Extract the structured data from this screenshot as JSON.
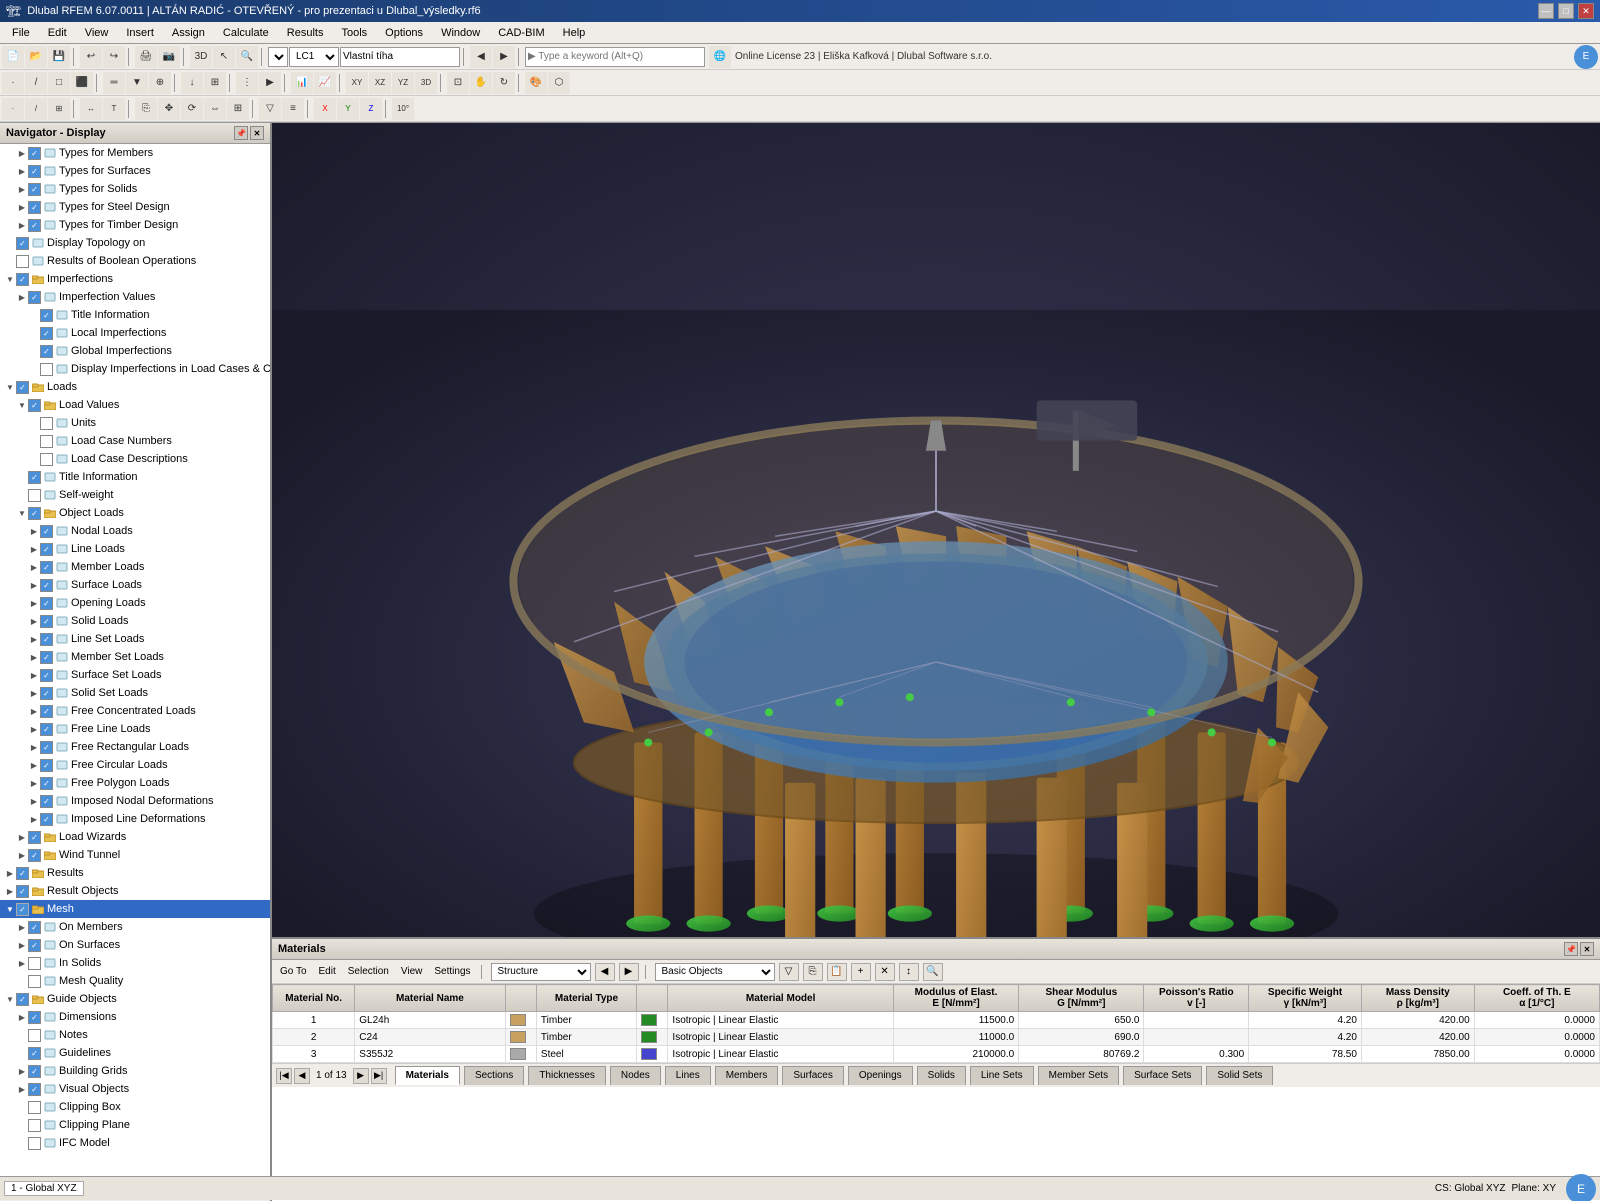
{
  "titleBar": {
    "text": "Dlubal RFEM 6.07.0011 | ALTÁN RADIĆ - OTEVŘENÝ - pro prezentaci u Dlubal_výsledky.rf6",
    "controls": [
      "—",
      "□",
      "✕"
    ]
  },
  "menuBar": {
    "items": [
      "File",
      "Edit",
      "View",
      "Insert",
      "Assign",
      "Calculate",
      "Results",
      "Tools",
      "Options",
      "Window",
      "CAD-BIM",
      "Help"
    ]
  },
  "toolbar1": {
    "searchPlaceholder": "▶ Type a keyword (Alt+Q)",
    "licenseText": "Online License 23 | Eliška Kafková | Dlubal Software s.r.o.",
    "loadCombo": "LC1",
    "loadName": "Vlastní tíha"
  },
  "navigator": {
    "title": "Navigator - Display",
    "items": [
      {
        "id": "types-members",
        "label": "Types for Members",
        "level": 1,
        "expand": "▶",
        "checked": true,
        "icon": "📋"
      },
      {
        "id": "types-surfaces",
        "label": "Types for Surfaces",
        "level": 1,
        "expand": "▶",
        "checked": true,
        "icon": "📋"
      },
      {
        "id": "types-solids",
        "label": "Types for Solids",
        "level": 1,
        "expand": "▶",
        "checked": true,
        "icon": "📋"
      },
      {
        "id": "types-steel",
        "label": "Types for Steel Design",
        "level": 1,
        "expand": "▶",
        "checked": true,
        "icon": "📋"
      },
      {
        "id": "types-timber",
        "label": "Types for Timber Design",
        "level": 1,
        "expand": "▶",
        "checked": true,
        "icon": "📋"
      },
      {
        "id": "display-topology",
        "label": "Display Topology on",
        "level": 0,
        "expand": "",
        "checked": true,
        "icon": "🔲"
      },
      {
        "id": "boolean-results",
        "label": "Results of Boolean Operations",
        "level": 0,
        "expand": "",
        "checked": false,
        "icon": "🔲"
      },
      {
        "id": "imperfections",
        "label": "Imperfections",
        "level": 0,
        "expand": "▼",
        "checked": true,
        "icon": "📁"
      },
      {
        "id": "imperfection-values",
        "label": "Imperfection Values",
        "level": 1,
        "expand": "▶",
        "checked": true,
        "icon": "📄"
      },
      {
        "id": "title-info-imp",
        "label": "Title Information",
        "level": 2,
        "expand": "",
        "checked": true,
        "icon": "📄"
      },
      {
        "id": "local-imperfections",
        "label": "Local Imperfections",
        "level": 2,
        "expand": "",
        "checked": true,
        "icon": "📄"
      },
      {
        "id": "global-imperfections",
        "label": "Global Imperfections",
        "level": 2,
        "expand": "",
        "checked": true,
        "icon": "📄"
      },
      {
        "id": "display-imperfections",
        "label": "Display Imperfections in Load Cases & Combi...",
        "level": 2,
        "expand": "",
        "checked": false,
        "icon": "📄"
      },
      {
        "id": "loads",
        "label": "Loads",
        "level": 0,
        "expand": "▼",
        "checked": true,
        "icon": "📁"
      },
      {
        "id": "load-values",
        "label": "Load Values",
        "level": 1,
        "expand": "▼",
        "checked": true,
        "icon": "📁"
      },
      {
        "id": "units",
        "label": "Units",
        "level": 2,
        "expand": "",
        "checked": false,
        "icon": "📄"
      },
      {
        "id": "load-case-numbers",
        "label": "Load Case Numbers",
        "level": 2,
        "expand": "",
        "checked": false,
        "icon": "📄"
      },
      {
        "id": "load-case-desc",
        "label": "Load Case Descriptions",
        "level": 2,
        "expand": "",
        "checked": false,
        "icon": "📄"
      },
      {
        "id": "title-info-loads",
        "label": "Title Information",
        "level": 1,
        "expand": "",
        "checked": true,
        "icon": "📄"
      },
      {
        "id": "self-weight",
        "label": "Self-weight",
        "level": 1,
        "expand": "",
        "checked": false,
        "icon": "📄"
      },
      {
        "id": "object-loads",
        "label": "Object Loads",
        "level": 1,
        "expand": "▼",
        "checked": true,
        "icon": "📁"
      },
      {
        "id": "nodal-loads",
        "label": "Nodal Loads",
        "level": 2,
        "expand": "▶",
        "checked": true,
        "icon": "📄"
      },
      {
        "id": "line-loads",
        "label": "Line Loads",
        "level": 2,
        "expand": "▶",
        "checked": true,
        "icon": "📄"
      },
      {
        "id": "member-loads",
        "label": "Member Loads",
        "level": 2,
        "expand": "▶",
        "checked": true,
        "icon": "📄"
      },
      {
        "id": "surface-loads",
        "label": "Surface Loads",
        "level": 2,
        "expand": "▶",
        "checked": true,
        "icon": "📄"
      },
      {
        "id": "opening-loads",
        "label": "Opening Loads",
        "level": 2,
        "expand": "▶",
        "checked": true,
        "icon": "📄"
      },
      {
        "id": "solid-loads",
        "label": "Solid Loads",
        "level": 2,
        "expand": "▶",
        "checked": true,
        "icon": "📄"
      },
      {
        "id": "line-set-loads",
        "label": "Line Set Loads",
        "level": 2,
        "expand": "▶",
        "checked": true,
        "icon": "📄"
      },
      {
        "id": "member-set-loads",
        "label": "Member Set Loads",
        "level": 2,
        "expand": "▶",
        "checked": true,
        "icon": "📄"
      },
      {
        "id": "surface-set-loads",
        "label": "Surface Set Loads",
        "level": 2,
        "expand": "▶",
        "checked": true,
        "icon": "📄"
      },
      {
        "id": "solid-set-loads",
        "label": "Solid Set Loads",
        "level": 2,
        "expand": "▶",
        "checked": true,
        "icon": "📄"
      },
      {
        "id": "free-conc-loads",
        "label": "Free Concentrated Loads",
        "level": 2,
        "expand": "▶",
        "checked": true,
        "icon": "📄"
      },
      {
        "id": "free-line-loads",
        "label": "Free Line Loads",
        "level": 2,
        "expand": "▶",
        "checked": true,
        "icon": "📄"
      },
      {
        "id": "free-rect-loads",
        "label": "Free Rectangular Loads",
        "level": 2,
        "expand": "▶",
        "checked": true,
        "icon": "📄"
      },
      {
        "id": "free-circ-loads",
        "label": "Free Circular Loads",
        "level": 2,
        "expand": "▶",
        "checked": true,
        "icon": "📄"
      },
      {
        "id": "free-poly-loads",
        "label": "Free Polygon Loads",
        "level": 2,
        "expand": "▶",
        "checked": true,
        "icon": "📄"
      },
      {
        "id": "imposed-nodal-def",
        "label": "Imposed Nodal Deformations",
        "level": 2,
        "expand": "▶",
        "checked": true,
        "icon": "📄"
      },
      {
        "id": "imposed-line-def",
        "label": "Imposed Line Deformations",
        "level": 2,
        "expand": "▶",
        "checked": true,
        "icon": "📄"
      },
      {
        "id": "load-wizards",
        "label": "Load Wizards",
        "level": 1,
        "expand": "▶",
        "checked": true,
        "icon": "📁"
      },
      {
        "id": "wind-tunnel",
        "label": "Wind Tunnel",
        "level": 1,
        "expand": "▶",
        "checked": true,
        "icon": "📁"
      },
      {
        "id": "results",
        "label": "Results",
        "level": 0,
        "expand": "▶",
        "checked": true,
        "icon": "📁"
      },
      {
        "id": "result-objects",
        "label": "Result Objects",
        "level": 0,
        "expand": "▶",
        "checked": true,
        "icon": "📁"
      },
      {
        "id": "mesh",
        "label": "Mesh",
        "level": 0,
        "expand": "▼",
        "checked": true,
        "icon": "📁",
        "selected": true
      },
      {
        "id": "on-members",
        "label": "On Members",
        "level": 1,
        "expand": "▶",
        "checked": true,
        "icon": "📄"
      },
      {
        "id": "on-surfaces",
        "label": "On Surfaces",
        "level": 1,
        "expand": "▶",
        "checked": true,
        "icon": "📄"
      },
      {
        "id": "in-solids",
        "label": "In Solids",
        "level": 1,
        "expand": "▶",
        "checked": false,
        "icon": "📄"
      },
      {
        "id": "mesh-quality",
        "label": "Mesh Quality",
        "level": 1,
        "expand": "",
        "checked": false,
        "icon": "📄"
      },
      {
        "id": "guide-objects",
        "label": "Guide Objects",
        "level": 0,
        "expand": "▼",
        "checked": true,
        "icon": "📁"
      },
      {
        "id": "dimensions",
        "label": "Dimensions",
        "level": 1,
        "expand": "▶",
        "checked": true,
        "icon": "📄"
      },
      {
        "id": "notes",
        "label": "Notes",
        "level": 1,
        "expand": "",
        "checked": false,
        "icon": "📄"
      },
      {
        "id": "guidelines",
        "label": "Guidelines",
        "level": 1,
        "expand": "",
        "checked": true,
        "icon": "📄"
      },
      {
        "id": "building-grids",
        "label": "Building Grids",
        "level": 1,
        "expand": "▶",
        "checked": true,
        "icon": "📄"
      },
      {
        "id": "visual-objects",
        "label": "Visual Objects",
        "level": 1,
        "expand": "▶",
        "checked": true,
        "icon": "📄"
      },
      {
        "id": "clipping-box",
        "label": "Clipping Box",
        "level": 1,
        "expand": "",
        "checked": false,
        "icon": "📄"
      },
      {
        "id": "clipping-plane",
        "label": "Clipping Plane",
        "level": 1,
        "expand": "",
        "checked": false,
        "icon": "📄"
      },
      {
        "id": "ifc-model",
        "label": "IFC Model",
        "level": 1,
        "expand": "",
        "checked": false,
        "icon": "📄"
      }
    ],
    "bottomIcons": [
      "👁",
      "⚙",
      "🎬",
      "📌"
    ]
  },
  "viewport": {
    "background": "#2a2a3a"
  },
  "materialsPanel": {
    "title": "Materials",
    "toolbar": {
      "goTo": "Go To",
      "edit": "Edit",
      "selection": "Selection",
      "view": "View",
      "settings": "Settings",
      "structureLabel": "Structure",
      "basicObjectsLabel": "Basic Objects"
    },
    "tableHeaders": [
      "Material No.",
      "Material Name",
      "",
      "Material Type",
      "",
      "Material Model",
      "Modulus of Elast. E [N/mm²]",
      "Shear Modulus G [N/mm²]",
      "Poisson's Ratio v [-]",
      "Specific Weight γ [kN/m³]",
      "Mass Density ρ [kg/m³]",
      "Coeff. of Th. E α [1/°C]"
    ],
    "rows": [
      {
        "no": "1",
        "name": "GL24h",
        "color": "#c8a060",
        "type": "Timber",
        "typeColor": "#228B22",
        "model": "Isotropic | Linear Elastic",
        "E": "11500.0",
        "G": "650.0",
        "v": "",
        "gamma": "4.20",
        "rho": "420.00",
        "alpha": "0.0000"
      },
      {
        "no": "2",
        "name": "C24",
        "color": "#c8a060",
        "type": "Timber",
        "typeColor": "#228B22",
        "model": "Isotropic | Linear Elastic",
        "E": "11000.0",
        "G": "690.0",
        "v": "",
        "gamma": "4.20",
        "rho": "420.00",
        "alpha": "0.0000"
      },
      {
        "no": "3",
        "name": "S355J2",
        "color": "#aaaaaa",
        "type": "Steel",
        "typeColor": "#4444cc",
        "model": "Isotropic | Linear Elastic",
        "E": "210000.0",
        "G": "80769.2",
        "v": "0.300",
        "gamma": "78.50",
        "rho": "7850.00",
        "alpha": "0.0000"
      }
    ],
    "pagination": {
      "current": "1",
      "total": "13"
    },
    "tabs": [
      "Materials",
      "Sections",
      "Thicknesses",
      "Nodes",
      "Lines",
      "Members",
      "Surfaces",
      "Openings",
      "Solids",
      "Line Sets",
      "Member Sets",
      "Surface Sets",
      "Solid Sets"
    ]
  },
  "statusBar": {
    "item1": "1 - Global XYZ",
    "cs": "CS: Global XYZ",
    "plane": "Plane: XY"
  }
}
